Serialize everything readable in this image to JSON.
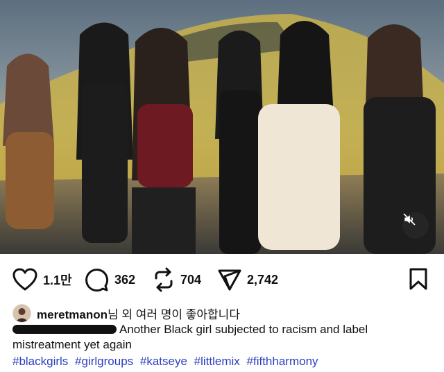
{
  "post": {
    "likes_count": "1.1만",
    "comments_count": "362",
    "reposts_count": "704",
    "shares_count": "2,742",
    "liked_by_user": "meretmanon",
    "liked_by_suffix": "님 외 여러 명이 좋아합니다",
    "caption_text": "Another Black girl subjected to racism and label mistreatment yet again",
    "hashtags": [
      "#blackgirls",
      "#girlgroups",
      "#katseye",
      "#littlemix",
      "#fifthharmony"
    ]
  },
  "icons": {
    "like": "heart-icon",
    "comment": "comment-bubble-icon",
    "repost": "repost-icon",
    "share": "send-icon",
    "save": "bookmark-icon",
    "mute": "speaker-muted-icon"
  },
  "colors": {
    "hashtag": "#2a3fbf",
    "text": "#111111",
    "background": "#ffffff"
  }
}
